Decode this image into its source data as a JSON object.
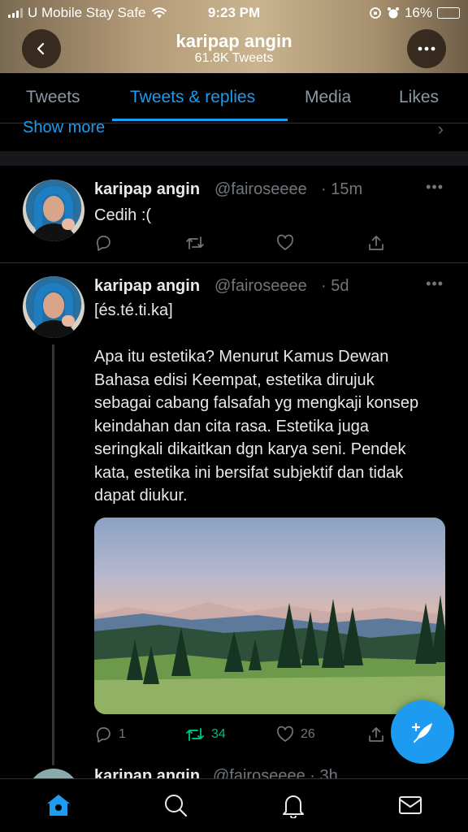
{
  "status_bar": {
    "carrier": "U Mobile Stay Safe",
    "time": "9:23 PM",
    "battery_percent": "16%",
    "battery_level": 0.16
  },
  "header": {
    "title": "karipap angin",
    "subtitle": "61.8K Tweets"
  },
  "tabs": [
    {
      "label": "Tweets",
      "active": false
    },
    {
      "label": "Tweets & replies",
      "active": true
    },
    {
      "label": "Media",
      "active": false
    },
    {
      "label": "Likes",
      "active": false
    }
  ],
  "show_more": "Show more",
  "tweets": [
    {
      "name": "karipap angin",
      "handle": "@fairoseeee",
      "time": "· 15m",
      "text": "Cedih :(",
      "replies": "",
      "retweets": "",
      "likes": ""
    },
    {
      "name": "karipap angin",
      "handle": "@fairoseeee",
      "time": "· 5d",
      "text": "[és.té.ti.ka]\n\nApa itu estetika? Menurut Kamus Dewan Bahasa edisi Keempat, estetika dirujuk sebagai cabang falsafah yg mengkaji konsep keindahan dan cita rasa. Estetika juga seringkali dikaitkan dgn karya seni. Pendek kata, estetika ini bersifat subjektif dan tidak dapat diukur.",
      "replies": "1",
      "retweets": "34",
      "likes": "26"
    }
  ],
  "peek_tweet": {
    "name": "karipap angin",
    "handle": "@fairoseeee · 3h"
  },
  "colors": {
    "accent": "#1d9bf0",
    "retweet_active": "#00ba7c",
    "muted": "#71767b"
  }
}
